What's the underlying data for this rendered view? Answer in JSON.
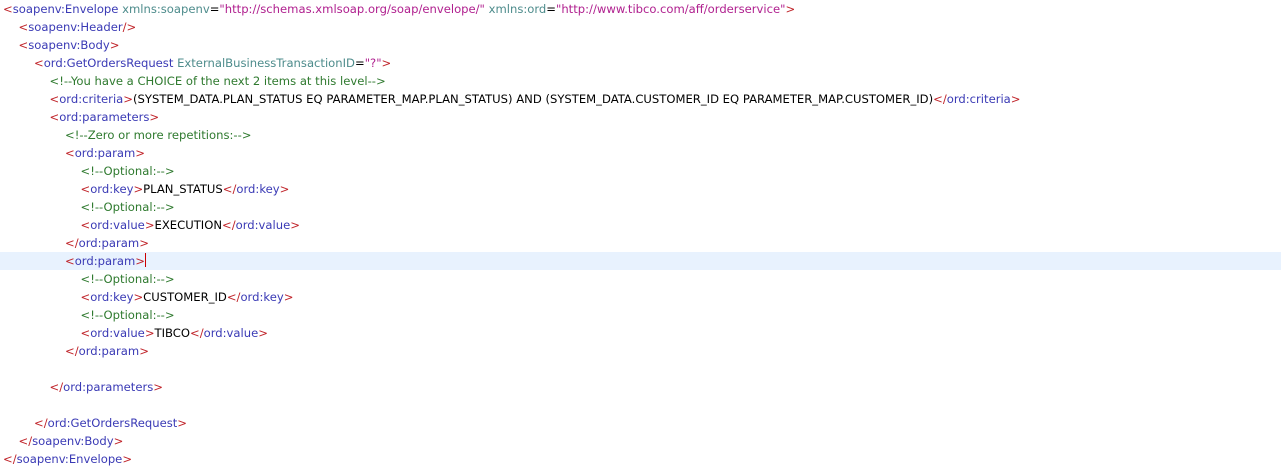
{
  "editor": {
    "current_line": 14,
    "colors": {
      "delimiter": "#c0242a",
      "tag": "#3a3ab5",
      "attr": "#4e8c8c",
      "value": "#b0208f",
      "comment": "#2f7a2f",
      "text": "#000000",
      "current_line_bg": "#e8f2fe"
    },
    "lines": [
      {
        "indent": 0,
        "tokens": [
          [
            "d",
            "<"
          ],
          [
            "t",
            "soapenv:Envelope"
          ],
          [
            "a",
            " xmlns:soapenv"
          ],
          [
            "e",
            "="
          ],
          [
            "v",
            "\"http://schemas.xmlsoap.org/soap/envelope/\""
          ],
          [
            "a",
            " xmlns:ord"
          ],
          [
            "e",
            "="
          ],
          [
            "v",
            "\"http://www.tibco.com/aff/orderservice\""
          ],
          [
            "d",
            ">"
          ]
        ]
      },
      {
        "indent": 1,
        "tokens": [
          [
            "d",
            "<"
          ],
          [
            "t",
            "soapenv:Header"
          ],
          [
            "d",
            "/>"
          ]
        ]
      },
      {
        "indent": 1,
        "tokens": [
          [
            "d",
            "<"
          ],
          [
            "t",
            "soapenv:Body"
          ],
          [
            "d",
            ">"
          ]
        ]
      },
      {
        "indent": 2,
        "tokens": [
          [
            "d",
            "<"
          ],
          [
            "t",
            "ord:GetOrdersRequest"
          ],
          [
            "a",
            " ExternalBusinessTransactionID"
          ],
          [
            "e",
            "="
          ],
          [
            "v",
            "\"?\""
          ],
          [
            "d",
            ">"
          ]
        ]
      },
      {
        "indent": 3,
        "tokens": [
          [
            "c",
            "<!--You have a CHOICE of the next 2 items at this level-->"
          ]
        ]
      },
      {
        "indent": 3,
        "tokens": [
          [
            "d",
            "<"
          ],
          [
            "t",
            "ord:criteria"
          ],
          [
            "d",
            ">"
          ],
          [
            "x",
            "(SYSTEM_DATA.PLAN_STATUS EQ PARAMETER_MAP.PLAN_STATUS) AND (SYSTEM_DATA.CUSTOMER_ID EQ PARAMETER_MAP.CUSTOMER_ID)"
          ],
          [
            "d",
            "</"
          ],
          [
            "t",
            "ord:criteria"
          ],
          [
            "d",
            ">"
          ]
        ]
      },
      {
        "indent": 3,
        "tokens": [
          [
            "d",
            "<"
          ],
          [
            "t",
            "ord:parameters"
          ],
          [
            "d",
            ">"
          ]
        ]
      },
      {
        "indent": 4,
        "tokens": [
          [
            "c",
            "<!--Zero or more repetitions:-->"
          ]
        ]
      },
      {
        "indent": 4,
        "tokens": [
          [
            "d",
            "<"
          ],
          [
            "t",
            "ord:param"
          ],
          [
            "d",
            ">"
          ]
        ]
      },
      {
        "indent": 5,
        "tokens": [
          [
            "c",
            "<!--Optional:-->"
          ]
        ]
      },
      {
        "indent": 5,
        "tokens": [
          [
            "d",
            "<"
          ],
          [
            "t",
            "ord:key"
          ],
          [
            "d",
            ">"
          ],
          [
            "x",
            "PLAN_STATUS"
          ],
          [
            "d",
            "</"
          ],
          [
            "t",
            "ord:key"
          ],
          [
            "d",
            ">"
          ]
        ]
      },
      {
        "indent": 5,
        "tokens": [
          [
            "c",
            "<!--Optional:-->"
          ]
        ]
      },
      {
        "indent": 5,
        "tokens": [
          [
            "d",
            "<"
          ],
          [
            "t",
            "ord:value"
          ],
          [
            "d",
            ">"
          ],
          [
            "x",
            "EXECUTION"
          ],
          [
            "d",
            "</"
          ],
          [
            "t",
            "ord:value"
          ],
          [
            "d",
            ">"
          ]
        ]
      },
      {
        "indent": 4,
        "tokens": [
          [
            "d",
            "</"
          ],
          [
            "t",
            "ord:param"
          ],
          [
            "d",
            ">"
          ]
        ]
      },
      {
        "indent": 4,
        "tokens": [
          [
            "d",
            "<"
          ],
          [
            "t",
            "ord:param"
          ],
          [
            "d",
            ">"
          ]
        ]
      },
      {
        "indent": 5,
        "tokens": [
          [
            "c",
            "<!--Optional:-->"
          ]
        ]
      },
      {
        "indent": 5,
        "tokens": [
          [
            "d",
            "<"
          ],
          [
            "t",
            "ord:key"
          ],
          [
            "d",
            ">"
          ],
          [
            "x",
            "CUSTOMER_ID"
          ],
          [
            "d",
            "</"
          ],
          [
            "t",
            "ord:key"
          ],
          [
            "d",
            ">"
          ]
        ]
      },
      {
        "indent": 5,
        "tokens": [
          [
            "c",
            "<!--Optional:-->"
          ]
        ]
      },
      {
        "indent": 5,
        "tokens": [
          [
            "d",
            "<"
          ],
          [
            "t",
            "ord:value"
          ],
          [
            "d",
            ">"
          ],
          [
            "x",
            "TIBCO"
          ],
          [
            "d",
            "</"
          ],
          [
            "t",
            "ord:value"
          ],
          [
            "d",
            ">"
          ]
        ]
      },
      {
        "indent": 4,
        "tokens": [
          [
            "d",
            "</"
          ],
          [
            "t",
            "ord:param"
          ],
          [
            "d",
            ">"
          ]
        ]
      },
      {
        "indent": 0,
        "tokens": []
      },
      {
        "indent": 3,
        "tokens": [
          [
            "d",
            "</"
          ],
          [
            "t",
            "ord:parameters"
          ],
          [
            "d",
            ">"
          ]
        ]
      },
      {
        "indent": 0,
        "tokens": []
      },
      {
        "indent": 2,
        "tokens": [
          [
            "d",
            "</"
          ],
          [
            "t",
            "ord:GetOrdersRequest"
          ],
          [
            "d",
            ">"
          ]
        ]
      },
      {
        "indent": 1,
        "tokens": [
          [
            "d",
            "</"
          ],
          [
            "t",
            "soapenv:Body"
          ],
          [
            "d",
            ">"
          ]
        ]
      },
      {
        "indent": 0,
        "tokens": [
          [
            "d",
            "</"
          ],
          [
            "t",
            "soapenv:Envelope"
          ],
          [
            "d",
            ">"
          ]
        ]
      }
    ]
  }
}
